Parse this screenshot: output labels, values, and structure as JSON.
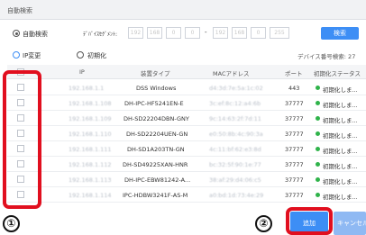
{
  "dialog": {
    "title": "自動検索"
  },
  "search": {
    "auto_label": "自動検索",
    "segment_label": "ﾃﾞﾊﾞｲｽｾｸﾞﾒﾝﾄ:",
    "ip_from": [
      "192",
      "168",
      "0",
      "0"
    ],
    "ip_to": [
      "192",
      "168",
      "0",
      "255"
    ],
    "search_button": "検索"
  },
  "toolbar": {
    "ip_change": "IP変更",
    "initialize": "初期化",
    "device_count": "デバイス番号検索: 27"
  },
  "table": {
    "columns": [
      "IP",
      "装置タイプ",
      "MACアドレス",
      "ポート",
      "初期化ステータス"
    ],
    "rows": [
      {
        "ip": "192.168.1.1",
        "type": "DSS Windows",
        "mac": "d4:3d:7e:5a:1c:02",
        "port": "443",
        "status": "初期化しま..."
      },
      {
        "ip": "192.168.1.108",
        "type": "DH-IPC-HF5241EN-E",
        "mac": "3c:ef:8c:12:a4:6b",
        "port": "37777",
        "status": "初期化しま..."
      },
      {
        "ip": "192.168.1.109",
        "type": "DH-SD22204DBN-GNY",
        "mac": "9c:14:63:2f:7d:11",
        "port": "37777",
        "status": "初期化しま..."
      },
      {
        "ip": "192.168.1.110",
        "type": "DH-SD22204UEN-GN",
        "mac": "e0:50:8b:4c:90:3a",
        "port": "37777",
        "status": "初期化しま..."
      },
      {
        "ip": "192.168.1.111",
        "type": "DH-SD1A203TN-GN",
        "mac": "4c:11:bf:62:e3:8d",
        "port": "37777",
        "status": "初期化しま..."
      },
      {
        "ip": "192.168.1.112",
        "type": "DH-SD49225XAN-HNR",
        "mac": "bc:32:5f:90:1e:77",
        "port": "37777",
        "status": "初期化しま..."
      },
      {
        "ip": "192.168.1.113",
        "type": "DH-IPC-EBW81242-A...",
        "mac": "38:af:29:d4:06:c5",
        "port": "37777",
        "status": "初期化しま..."
      },
      {
        "ip": "192.168.1.114",
        "type": "IPC-HDBW3241F-AS-M",
        "mac": "a0:bd:1d:73:4e:29",
        "port": "37777",
        "status": "初期化しま..."
      }
    ]
  },
  "footer": {
    "add_button": "追加",
    "cancel_button": "キャンセル"
  },
  "annotations": {
    "marker_1": "①",
    "marker_2": "②"
  },
  "colors": {
    "accent": "#3d8ef5",
    "highlight": "#e10f1f",
    "status_ok": "#2fb34a"
  }
}
